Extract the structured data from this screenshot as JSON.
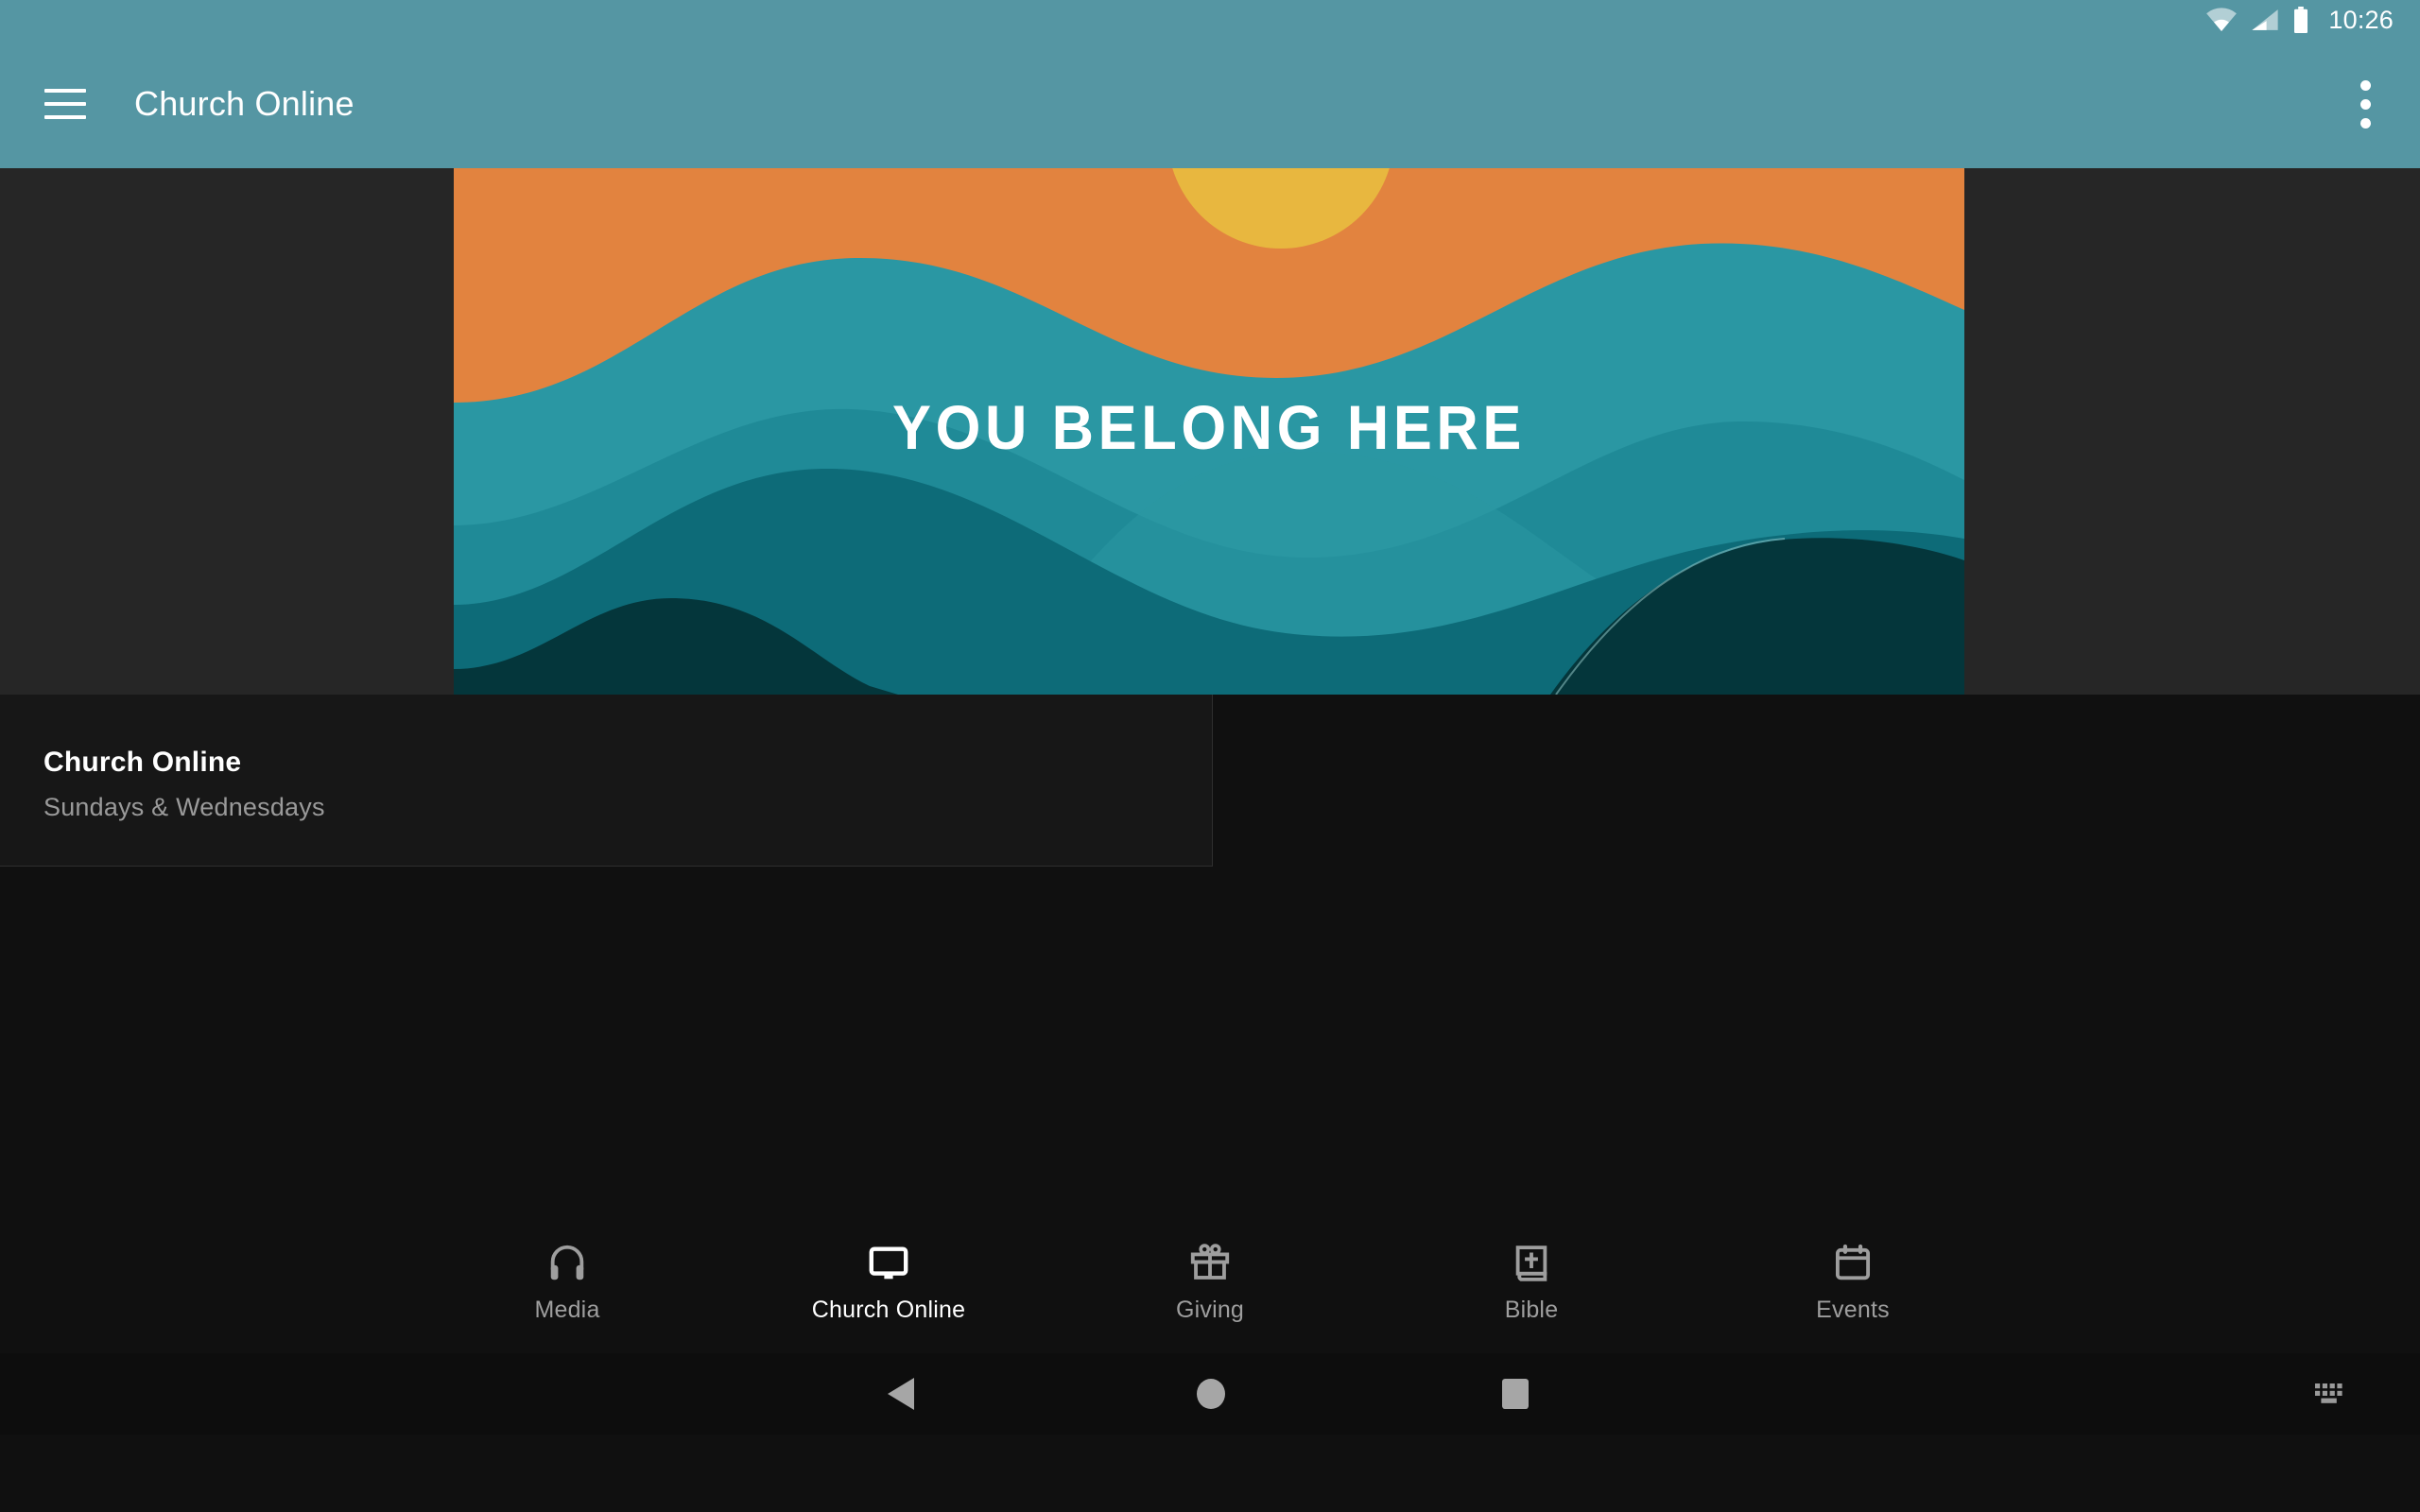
{
  "status_bar": {
    "clock": "10:26",
    "icons": [
      "wifi-icon",
      "cell-signal-icon",
      "battery-icon"
    ]
  },
  "app_bar": {
    "menu_icon": "hamburger-menu-icon",
    "title": "Church Online",
    "overflow_icon": "overflow-menu-icon"
  },
  "hero": {
    "caption": "YOU BELONG HERE",
    "colors": {
      "sky": "#e2833f",
      "sun": "#e8b73f",
      "wave1": "#2a97a3",
      "wave2": "#1f8a97",
      "wave3": "#0d6b78",
      "wave4": "#075e6b",
      "wave5": "#04363b"
    }
  },
  "card": {
    "title": "Church Online",
    "subtitle": "Sundays & Wednesdays"
  },
  "bottom_nav": {
    "items": [
      {
        "label": "Media",
        "icon": "headphones-icon",
        "active": false
      },
      {
        "label": "Church Online",
        "icon": "monitor-icon",
        "active": true
      },
      {
        "label": "Giving",
        "icon": "gift-icon",
        "active": false
      },
      {
        "label": "Bible",
        "icon": "bible-book-icon",
        "active": false
      },
      {
        "label": "Events",
        "icon": "calendar-icon",
        "active": false
      }
    ]
  },
  "system_nav": {
    "back_icon": "back-triangle-icon",
    "home_icon": "home-circle-icon",
    "recents_icon": "recents-square-icon",
    "keyboard_icon": "keyboard-switcher-icon"
  },
  "theme": {
    "accent": "#5596a3",
    "background": "#101010",
    "card_background": "#171717",
    "letterbox": "#262626"
  }
}
